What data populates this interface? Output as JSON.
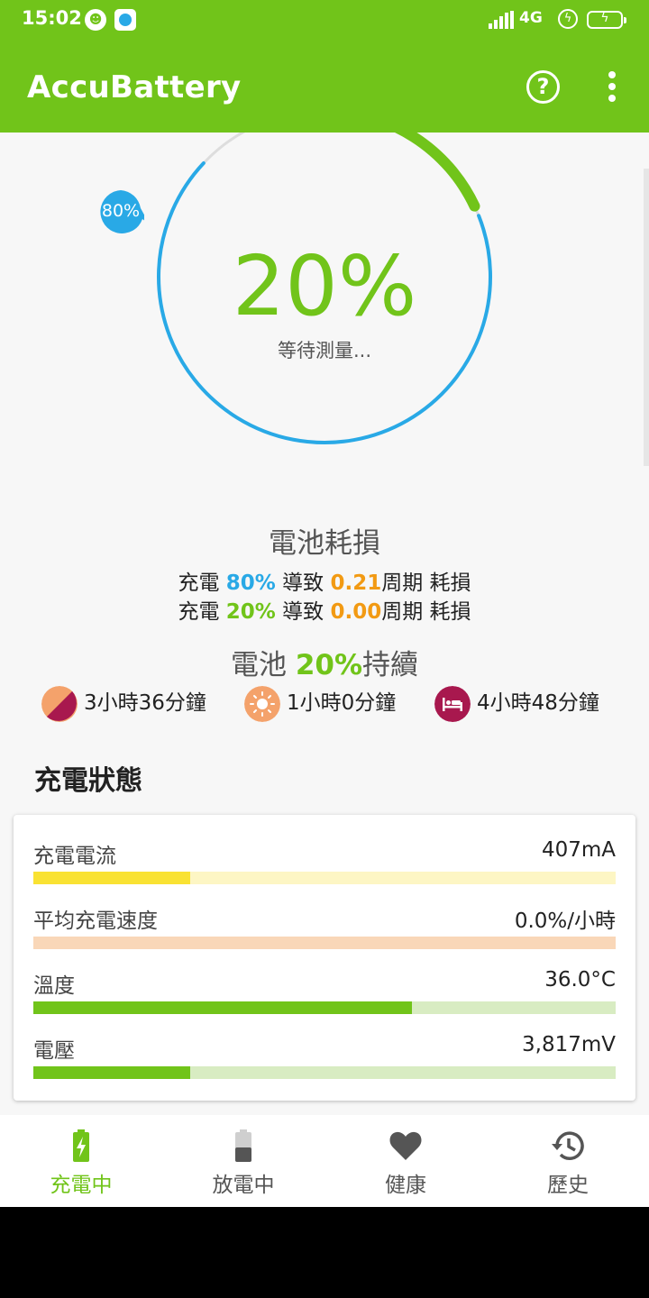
{
  "status_bar": {
    "time": "15:02",
    "network": "4G",
    "battery_icon": "charging-battery-icon",
    "icons": [
      "grinning-face-icon",
      "app-notification-icon",
      "signal-icon",
      "charging-bolt-icon"
    ]
  },
  "app_bar": {
    "title": "AccuBattery",
    "help_icon": "help-circle-icon",
    "menu_icon": "more-vert-icon"
  },
  "gauge": {
    "percent": "20%",
    "status": "等待測量...",
    "alarm_badge": "80%",
    "charge_level": 0.2,
    "target_level": 0.8
  },
  "battery_wear": {
    "title": "電池耗損",
    "lines": [
      {
        "prefix": "充電 ",
        "pct": "80%",
        "mid": " 導致 ",
        "cycles": "0.21",
        "suffix": "周期 耗損"
      },
      {
        "prefix": "充電 ",
        "pct": "20%",
        "mid": " 導致 ",
        "cycles": "0.00",
        "suffix": "周期 耗損"
      }
    ]
  },
  "battery_lasts": {
    "prefix": "電池 ",
    "pct": "20%",
    "suffix": "持續"
  },
  "estimates": [
    {
      "icon": "screen-mixed-icon",
      "label": "3小時36分鐘"
    },
    {
      "icon": "screen-on-sun-icon",
      "label": "1小時0分鐘"
    },
    {
      "icon": "sleep-bed-icon",
      "label": "4小時48分鐘"
    }
  ],
  "charging_status": {
    "title": "充電狀態",
    "rows": [
      {
        "name": "充電電流",
        "value": "407mA",
        "level": 0.27,
        "fill": "#f9e233",
        "track": "#fdf6c4"
      },
      {
        "name": "平均充電速度",
        "value": "0.0%/小時",
        "level": 0.0,
        "fill": "#f7c9a2",
        "track": "#f9d7b8"
      },
      {
        "name": "溫度",
        "value": "36.0°C",
        "level": 0.65,
        "fill": "#71c41a",
        "track": "#d8ecc2"
      },
      {
        "name": "電壓",
        "value": "3,817mV",
        "level": 0.27,
        "fill": "#71c41a",
        "track": "#d8ecc2"
      }
    ]
  },
  "bottom_nav": {
    "tabs": [
      {
        "label": "充電中",
        "icon": "battery-charging-icon",
        "active": true
      },
      {
        "label": "放電中",
        "icon": "battery-discharging-icon",
        "active": false
      },
      {
        "label": "健康",
        "icon": "heart-icon",
        "active": false
      },
      {
        "label": "歷史",
        "icon": "history-icon",
        "active": false
      }
    ]
  },
  "colors": {
    "accent": "#71c41a",
    "blue": "#29a9e6",
    "orange": "#f29a13"
  }
}
